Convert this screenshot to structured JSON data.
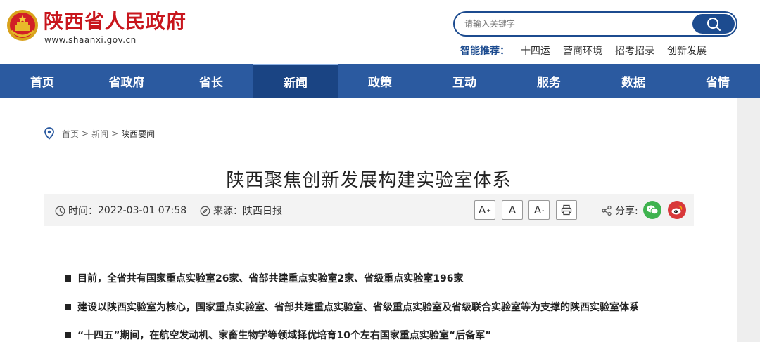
{
  "header": {
    "site_title": "陕西省人民政府",
    "site_domain": "www.shaanxi.gov.cn",
    "emblem_icon": "national-emblem-icon"
  },
  "search": {
    "placeholder": "请输入关键字",
    "button_icon": "search-icon"
  },
  "recommend": {
    "label": "智能推荐：",
    "items": [
      "十四运",
      "营商环境",
      "招考招录",
      "创新发展"
    ]
  },
  "nav": {
    "items": [
      "首页",
      "省政府",
      "省长",
      "新闻",
      "政策",
      "互动",
      "服务",
      "数据",
      "省情"
    ],
    "active": "新闻"
  },
  "breadcrumb": {
    "icon": "location-pin-icon",
    "items": [
      "首页",
      "新闻",
      "陕西要闻"
    ],
    "separator": ">"
  },
  "article": {
    "title": "陕西聚焦创新发展构建实验室体系",
    "time_label": "时间：",
    "time_value": "2022-03-01 07:58",
    "source_label": "来源：",
    "source_value": "陕西日报",
    "font_controls": [
      {
        "label": "A",
        "suffix": "+"
      },
      {
        "label": "A",
        "suffix": ""
      },
      {
        "label": "A",
        "suffix": "-"
      }
    ],
    "print_icon": "print-icon",
    "share_label": "分享:",
    "share_icons": [
      "wechat-icon",
      "weibo-icon"
    ],
    "bullets": [
      "目前，全省共有国家重点实验室26家、省部共建重点实验室2家、省级重点实验室196家",
      "建设以陕西实验室为核心，国家重点实验室、省部共建重点实验室、省级重点实验室及省级联合实验室等为支撑的陕西实验室体系",
      "“十四五”期间，在航空发动机、家畜生物学等领域择优培育10个左右国家重点实验室“后备军”"
    ]
  },
  "colors": {
    "brand_red": "#c8161d",
    "nav_blue": "#2b5aa0",
    "nav_active": "#1a4483",
    "wechat_green": "#3fb34f",
    "weibo_red": "#d8383a"
  }
}
